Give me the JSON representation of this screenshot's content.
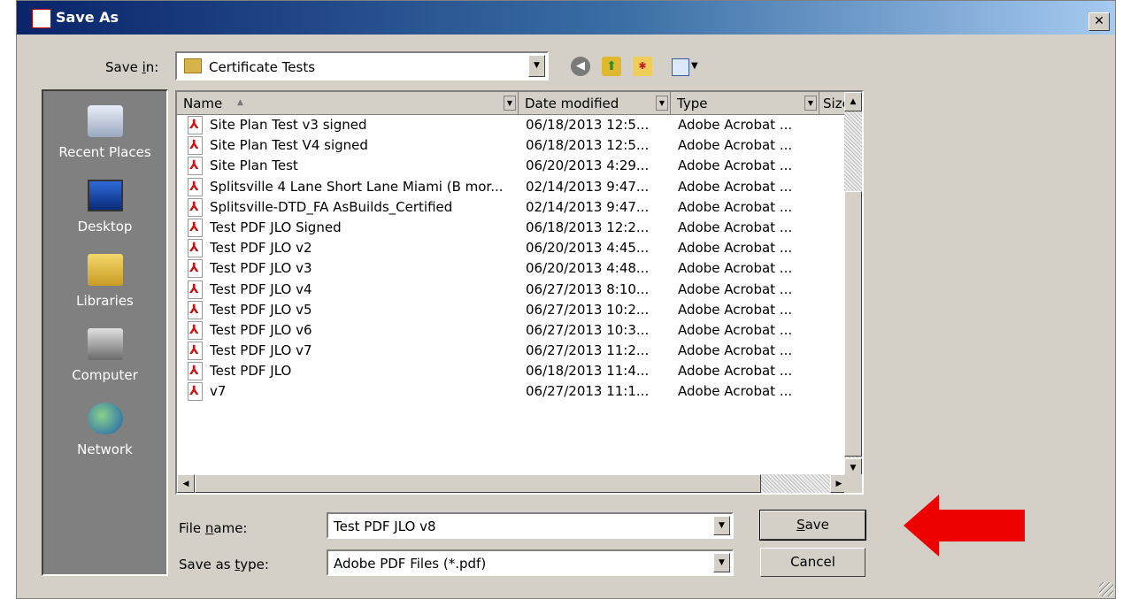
{
  "window": {
    "title": "Save As",
    "close_label": "✕"
  },
  "toolbar": {
    "save_in_label_prefix": "Save ",
    "save_in_label_key": "i",
    "save_in_label_suffix": "n:",
    "save_in_value": "Certificate Tests",
    "icons": [
      "back-icon",
      "up-folder-icon",
      "new-folder-icon",
      "views-icon"
    ]
  },
  "places": [
    {
      "label": "Recent Places",
      "icon": "recent-places-icon"
    },
    {
      "label": "Desktop",
      "icon": "desktop-icon"
    },
    {
      "label": "Libraries",
      "icon": "libraries-icon"
    },
    {
      "label": "Computer",
      "icon": "computer-icon"
    },
    {
      "label": "Network",
      "icon": "network-icon"
    }
  ],
  "columns": {
    "name": "Name",
    "date": "Date modified",
    "type": "Type",
    "size": "Size"
  },
  "files": [
    {
      "name": "Site Plan Test v3 signed",
      "date": "06/18/2013 12:5...",
      "type": "Adobe Acrobat ..."
    },
    {
      "name": "Site Plan Test V4 signed",
      "date": "06/18/2013 12:5...",
      "type": "Adobe Acrobat ..."
    },
    {
      "name": "Site Plan Test",
      "date": "06/20/2013 4:29...",
      "type": "Adobe Acrobat ..."
    },
    {
      "name": "Splitsville 4 Lane Short Lane Miami (B mor...",
      "date": "02/14/2013 9:47...",
      "type": "Adobe Acrobat ..."
    },
    {
      "name": "Splitsville-DTD_FA AsBuilds_Certified",
      "date": "02/14/2013 9:47...",
      "type": "Adobe Acrobat ..."
    },
    {
      "name": "Test PDF JLO Signed",
      "date": "06/18/2013 12:2...",
      "type": "Adobe Acrobat ..."
    },
    {
      "name": "Test PDF JLO v2",
      "date": "06/20/2013 4:45...",
      "type": "Adobe Acrobat ..."
    },
    {
      "name": "Test PDF JLO v3",
      "date": "06/20/2013 4:48...",
      "type": "Adobe Acrobat ..."
    },
    {
      "name": "Test PDF JLO v4",
      "date": "06/27/2013 8:10...",
      "type": "Adobe Acrobat ..."
    },
    {
      "name": "Test PDF JLO v5",
      "date": "06/27/2013 10:2...",
      "type": "Adobe Acrobat ..."
    },
    {
      "name": "Test PDF JLO v6",
      "date": "06/27/2013 10:3...",
      "type": "Adobe Acrobat ..."
    },
    {
      "name": "Test PDF JLO v7",
      "date": "06/27/2013 11:2...",
      "type": "Adobe Acrobat ..."
    },
    {
      "name": "Test PDF JLO",
      "date": "06/18/2013 11:4...",
      "type": "Adobe Acrobat ..."
    },
    {
      "name": "v7",
      "date": "06/27/2013 11:1...",
      "type": "Adobe Acrobat ..."
    }
  ],
  "form": {
    "file_name_prefix": "File ",
    "file_name_key": "n",
    "file_name_suffix": "ame:",
    "file_name_value": "Test PDF JLO v8",
    "save_type_prefix": "Save as ",
    "save_type_key": "t",
    "save_type_suffix": "ype:",
    "save_type_value": "Adobe PDF Files (*.pdf)"
  },
  "buttons": {
    "save_key": "S",
    "save_rest": "ave",
    "cancel": "Cancel"
  },
  "annotation": {
    "arrow_color": "#ee0000",
    "points_to": "save-button"
  },
  "colors": {
    "title_bar_start": "#0a246a",
    "title_bar_end": "#a6caf0",
    "dialog_bg": "#d4d0c8",
    "places_bg": "#808080"
  }
}
